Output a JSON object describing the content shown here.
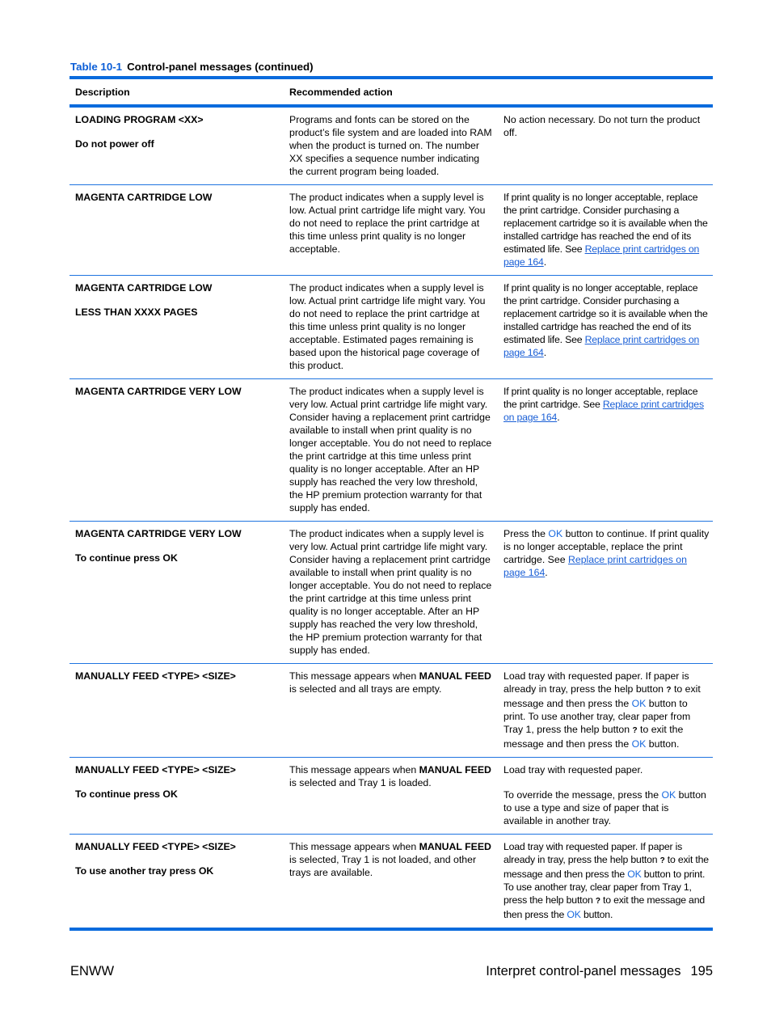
{
  "caption": {
    "number": "Table 10-1",
    "title": "Control-panel messages (continued)"
  },
  "table": {
    "headers": [
      "Description",
      "Recommended action"
    ],
    "rows": [
      {
        "desc": [
          "LOADING PROGRAM <XX>",
          "Do not power off"
        ],
        "action": "Programs and fonts can be stored on the product’s file system and are loaded into RAM when the product is turned on. The number XX specifies a sequence number indicating the current program being loaded.",
        "remedy": {
          "text": "No action necessary. Do not turn the product off."
        }
      },
      {
        "desc": [
          "MAGENTA CARTRIDGE LOW"
        ],
        "action": "The product indicates when a supply level is low. Actual print cartridge life might vary. You do not need to replace the print cartridge at this time unless print quality is no longer acceptable.",
        "remedy": {
          "text": "If print quality is no longer acceptable, replace the print cartridge. Consider purchasing a replacement cartridge so it is available when the installed cartridge has reached the end of its estimated life. See ",
          "link": "Replace print cartridges on page 164",
          "after": "."
        }
      },
      {
        "desc": [
          "MAGENTA CARTRIDGE LOW",
          "LESS THAN XXXX PAGES"
        ],
        "action": "The product indicates when a supply level is low. Actual print cartridge life might vary. You do not need to replace the print cartridge at this time unless print quality is no longer acceptable. Estimated pages remaining is based upon the historical page coverage of this product.",
        "remedy": {
          "text": "If print quality is no longer acceptable, replace the print cartridge. Consider purchasing a replacement cartridge so it is available when the installed cartridge has reached the end of its estimated life. See ",
          "link": "Replace print cartridges on page 164",
          "after": "."
        }
      },
      {
        "desc": [
          "MAGENTA CARTRIDGE VERY LOW"
        ],
        "action": "The product indicates when a supply level is very low. Actual print cartridge life might vary. Consider having a replacement print cartridge available to install when print quality is no longer acceptable. You do not need to replace the print cartridge at this time unless print quality is no longer acceptable. After an HP supply has reached the very low threshold, the HP premium protection warranty for that supply has ended.",
        "remedy": {
          "text": "If print quality is no longer acceptable, replace the print cartridge. See ",
          "link": "Replace print cartridges on page 164",
          "after": "."
        }
      },
      {
        "desc": [
          "MAGENTA CARTRIDGE VERY LOW",
          "To continue press OK"
        ],
        "action": "The product indicates when a supply level is very low. Actual print cartridge life might vary. Consider having a replacement print cartridge available to install when print quality is no longer acceptable. You do not need to replace the print cartridge at this time unless print quality is no longer acceptable. After an HP supply has reached the very low threshold, the HP premium protection warranty for that supply has ended.",
        "remedy": {
          "pre": "Press the ",
          "ok": "OK",
          "text": " button to continue. If print quality is no longer acceptable, replace the print cartridge. See ",
          "link": "Replace print cartridges on page 164",
          "after": "."
        }
      },
      {
        "desc": [
          "MANUALLY FEED <TYPE> <SIZE>"
        ],
        "action": {
          "pre": "This message appears when ",
          "bold": "MANUAL FEED",
          "post": " is selected and all trays are empty."
        },
        "remedy": {
          "p1": "Load tray with requested paper. If paper is already in tray, press the help button ",
          "help": "?",
          "p2": " to exit message and then press the ",
          "ok": "OK",
          "p3": " button to print. To use another tray, clear paper from Tray 1, press the help button ",
          "p4": " to exit the message and then press the ",
          "p5": " button."
        }
      },
      {
        "desc": [
          "MANUALLY FEED <TYPE> <SIZE>",
          "To continue press OK"
        ],
        "action": {
          "pre": "This message appears when ",
          "bold": "MANUAL FEED",
          "post": " is selected and Tray 1 is loaded."
        },
        "remedy": {
          "first": "Load tray with requested paper.",
          "pre": "To override the message, press the ",
          "ok": "OK",
          "post": " button to use a type and size of paper that is available in another tray."
        }
      },
      {
        "desc": [
          "MANUALLY FEED <TYPE> <SIZE>",
          "To use another tray press OK"
        ],
        "action": {
          "pre": "This message appears when ",
          "bold": "MANUAL FEED",
          "post": " is selected, Tray 1 is not loaded, and other trays are available."
        },
        "remedy": {
          "p1": "Load tray with requested paper. If paper is already in tray, press the help button ",
          "help": "?",
          "p2": " to exit the message and then press the ",
          "ok": "OK",
          "p3": " button to print. To use another tray, clear paper from Tray 1, press the help button ",
          "p4": " to exit the message and then press the ",
          "p5": " button."
        }
      }
    ]
  },
  "footer": {
    "left": "ENWW",
    "section": "Interpret control-panel messages",
    "page": "195"
  }
}
